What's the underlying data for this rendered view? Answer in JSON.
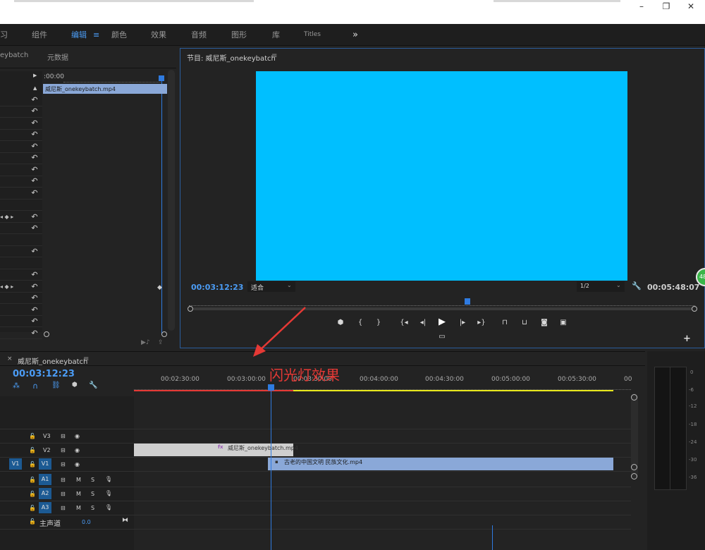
{
  "window": {
    "minimize_glyph": "–",
    "restore_glyph": "❐",
    "close_glyph": "✕"
  },
  "workspaces": {
    "items": [
      "习",
      "组件",
      "编辑",
      "颜色",
      "效果",
      "音频",
      "图形",
      "库",
      "Titles"
    ],
    "more_glyph": "»",
    "menu_glyph": "≡"
  },
  "source_panel": {
    "tab1": "eybatch",
    "tab2": "元数据",
    "timecode": ":00:00",
    "clip_label": "威尼斯_onekeybatch.mp4"
  },
  "program": {
    "title": "节目: 威尼斯_onekeybatch",
    "menu_glyph": "≡",
    "current_timecode": "00:03:12:23",
    "fit_label": "适合",
    "resolution": "1/2",
    "duration_timecode": "00:05:48:07",
    "badge": "48",
    "add_glyph": "+"
  },
  "timeline": {
    "close_glyph": "×",
    "sequence_name": "威尼斯_onekeybatch",
    "menu_glyph": "≡",
    "current_timecode": "00:03:12:23",
    "ruler": [
      "00:02:30:00",
      "00:03:00:00",
      "00:03:30:00",
      "00:04:00:00",
      "00:04:30:00",
      "00:05:00:00",
      "00:05:30:00",
      "00"
    ],
    "annotation": "闪光灯效果",
    "tracks": {
      "v3": "V3",
      "v2": "V2",
      "v1": "V1",
      "v1_target": "V1",
      "a1": "A1",
      "a2": "A2",
      "a3": "A3",
      "a1_target": "A1",
      "m": "M",
      "s": "S",
      "master_label": "主声道",
      "master_value": "0.0"
    },
    "clip_v2": "威尼斯_onekeybatch.mp4",
    "clip_v1": "古老的中国文明 民族文化.mp4",
    "fx_badge": "fx"
  },
  "meter": {
    "scale": [
      "0",
      "-6",
      "-12",
      "-18",
      "-24",
      "-30",
      "-36"
    ]
  },
  "colors": {
    "accent": "#4b9cf5",
    "video_fill": "#00bfff",
    "clip_blue": "#8aa8d8",
    "clip_gray": "#cfcfcf",
    "annotation": "#e53935"
  }
}
